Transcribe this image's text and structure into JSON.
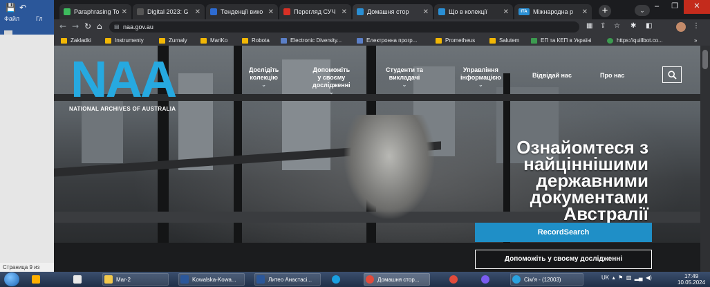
{
  "word": {
    "menu_file": "Файл",
    "menu_partial": "Гл",
    "status": "Страница 9 из"
  },
  "browser": {
    "tabs": [
      {
        "title": "Paraphrasing To",
        "favicon_color": "#3dbb5d",
        "active": false
      },
      {
        "title": "Digital 2023: G",
        "favicon_color": "#555555",
        "active": false
      },
      {
        "title": "Тенденції вико",
        "favicon_color": "#2d6bd1",
        "active": false
      },
      {
        "title": "Перегляд СУЧ",
        "favicon_color": "#d93025",
        "active": false
      },
      {
        "title": "Домашня стор",
        "favicon_color": "#2a8fd4",
        "active": true
      },
      {
        "title": "Що в колекції",
        "favicon_color": "#2a8fd4",
        "active": false
      },
      {
        "title": "Міжнародна р",
        "favicon_color": "#2a8fd4",
        "active": false
      }
    ],
    "tab_prefix_6": "ITA",
    "tab_menu_glyph": "⌄",
    "url": "naa.gov.au",
    "bookmarks": [
      {
        "label": "Zakladki",
        "color": "#f2b705"
      },
      {
        "label": "Instrumenty",
        "color": "#f2b705"
      },
      {
        "label": "Zurnaly",
        "color": "#f2b705"
      },
      {
        "label": "MariKo",
        "color": "#f2b705"
      },
      {
        "label": "Robota",
        "color": "#f2b705"
      },
      {
        "label": "Electronic Diversity...",
        "color": "#5b7fc7"
      },
      {
        "label": "Електронна прогр...",
        "color": "#5b7fc7"
      },
      {
        "label": "Prometheus",
        "color": "#f2b705"
      },
      {
        "label": "Salutem",
        "color": "#f2b705"
      },
      {
        "label": "ЕП та КЕП в Україні",
        "color": "#3c9b50"
      },
      {
        "label": "https://quillbot.co...",
        "color": "#3c9b50"
      }
    ],
    "bookmarks_more": "»"
  },
  "site": {
    "logo_letters": "NAA",
    "logo_subtitle": "NATIONAL ARCHIVES OF AUSTRALIA",
    "nav": [
      {
        "line1": "Дослідіть",
        "line2": "колекцію",
        "line3": ""
      },
      {
        "line1": "Допоможіть",
        "line2": "у своєму",
        "line3": "дослідженні"
      },
      {
        "line1": "Студенти та",
        "line2": "викладачі",
        "line3": ""
      },
      {
        "line1": "Управління",
        "line2": "інформацією",
        "line3": ""
      },
      {
        "line1": "Відвідай нас",
        "line2": "",
        "line3": ""
      },
      {
        "line1": "Про нас",
        "line2": "",
        "line3": ""
      }
    ],
    "nav_chevron": "⌄",
    "hero_line1": "Ознайомтеся з",
    "hero_line2": "найціннішими",
    "hero_line3": "державними",
    "hero_line4": "документами",
    "hero_line5": "Австралії",
    "recordsearch_label": "RecordSearch",
    "help_label": "Допоможіть у своєму дослідженні",
    "accent": "#26a9e0"
  },
  "taskbar": {
    "items": [
      {
        "label": "",
        "color": "#ffb000"
      },
      {
        "label": "",
        "color": "#e8e8e8"
      },
      {
        "label": "Mar-2",
        "color": "#f2c94c"
      },
      {
        "label": "Kowalska-Kowa...",
        "color": "#2b579a"
      },
      {
        "label": "Литео Анастасі...",
        "color": "#2b579a"
      },
      {
        "label": "",
        "color": "#1a9fe0"
      },
      {
        "label": "Домашня стор...",
        "color": "#e24b3b"
      },
      {
        "label": "",
        "color": "#e24b3b"
      },
      {
        "label": "",
        "color": "#7a5cf0"
      },
      {
        "label": "Сім'я - (12003)",
        "color": "#2aa1de"
      }
    ],
    "tray_lang": "UK",
    "time": "17:49",
    "date": "10.05.2024"
  }
}
